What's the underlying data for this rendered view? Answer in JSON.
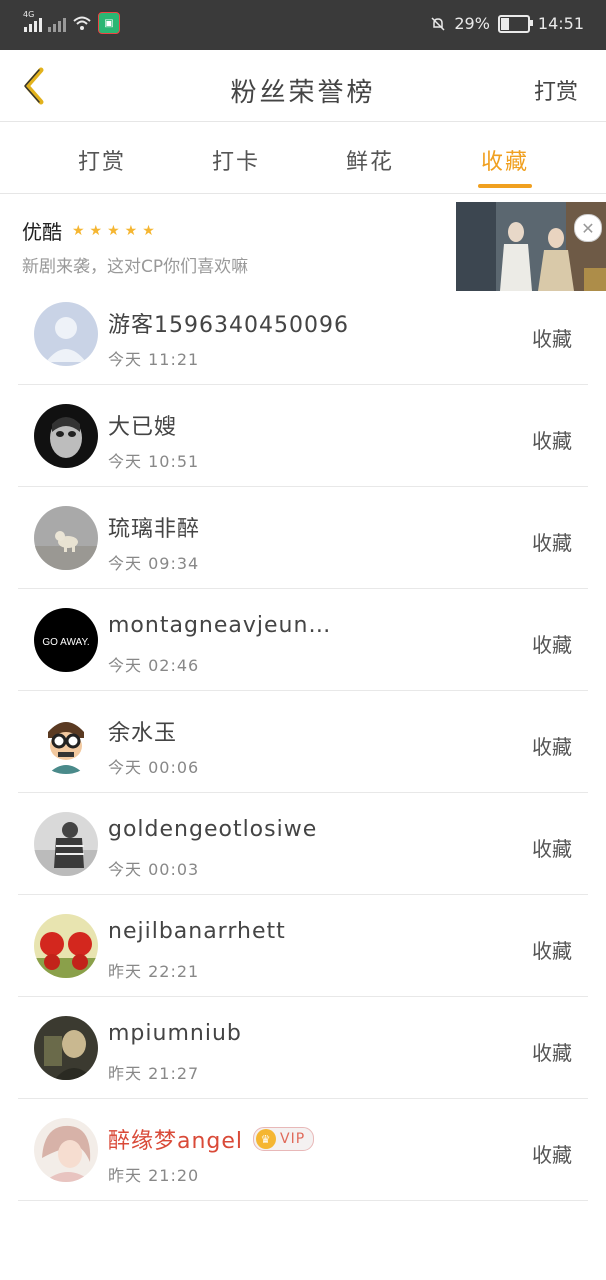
{
  "status_bar": {
    "network": "4G",
    "battery": "29%",
    "time": "14:51",
    "battery_level": 0.29,
    "icons": [
      "signal-icon",
      "wifi-icon",
      "app-notification-icon",
      "mute-bell-icon",
      "battery-icon"
    ]
  },
  "header": {
    "back_icon": "chevron-left-icon",
    "title": "粉丝荣誉榜",
    "right_action": "打赏"
  },
  "tabs": [
    {
      "label": "打赏",
      "active": false
    },
    {
      "label": "打卡",
      "active": false
    },
    {
      "label": "鲜花",
      "active": false
    },
    {
      "label": "收藏",
      "active": true
    }
  ],
  "ad": {
    "brand": "优酷",
    "rating_stars": 5,
    "stars": "★★★★★",
    "description": "新剧来袭，这对CP你们喜欢嘛",
    "close_icon": "close-icon"
  },
  "list": [
    {
      "name": "游客1596340450096",
      "time": "今天 11:21",
      "action": "收藏",
      "avatar": "default"
    },
    {
      "name": "大已嫂",
      "time": "今天 10:51",
      "action": "收藏",
      "avatar": "doll"
    },
    {
      "name": "琉璃非醉",
      "time": "今天 09:34",
      "action": "收藏",
      "avatar": "dog"
    },
    {
      "name": "montagneavjeun…",
      "time": "今天 02:46",
      "action": "收藏",
      "avatar": "goaway",
      "avatar_text": "GO AWAY."
    },
    {
      "name": "余水玉",
      "time": "今天 00:06",
      "action": "收藏",
      "avatar": "cartoon"
    },
    {
      "name": "goldengeotlosiwe",
      "time": "今天 00:03",
      "action": "收藏",
      "avatar": "photo-bw"
    },
    {
      "name": "nejilbanarrhett",
      "time": "昨天 22:21",
      "action": "收藏",
      "avatar": "red"
    },
    {
      "name": "mpiumniub",
      "time": "昨天 21:27",
      "action": "收藏",
      "avatar": "dark"
    },
    {
      "name": "醉缘梦angel",
      "time": "昨天 21:20",
      "action": "收藏",
      "avatar": "girl",
      "vip": true,
      "vip_label": "VIP"
    }
  ],
  "colors": {
    "accent": "#f0a020",
    "vip_name": "#d94a38",
    "star": "#f5b632",
    "status_bar": "#3a3a3a"
  }
}
